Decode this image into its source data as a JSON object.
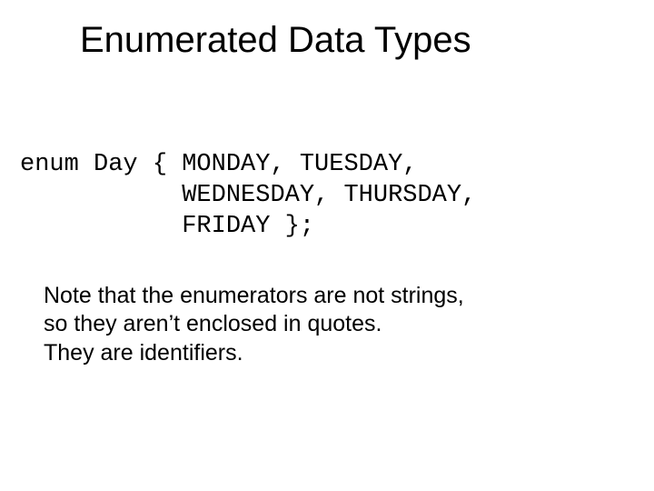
{
  "title": "Enumerated Data Types",
  "code": {
    "line1": "enum Day { MONDAY, TUESDAY,",
    "line2": "           WEDNESDAY, THURSDAY,",
    "line3": "           FRIDAY };"
  },
  "note": {
    "line1": "Note that the enumerators are not strings,",
    "line2": "so they aren’t enclosed in quotes.",
    "line3": "They are identifiers."
  }
}
